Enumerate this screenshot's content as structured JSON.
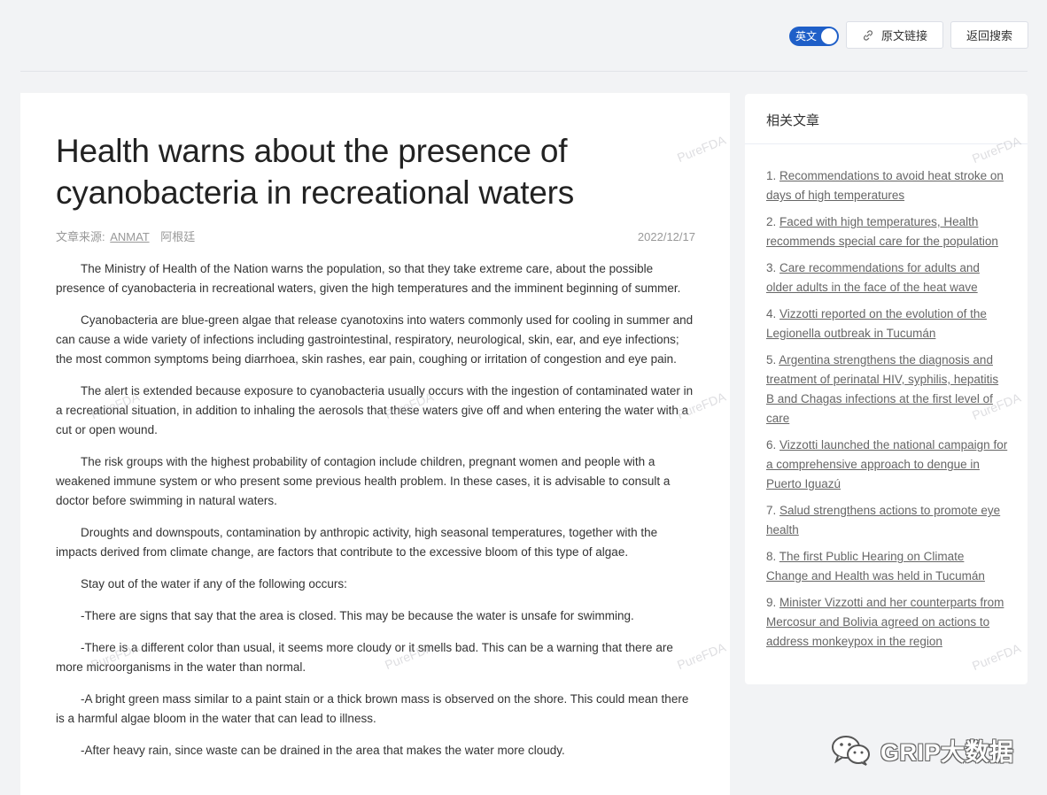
{
  "header": {
    "lang_toggle_label": "英文",
    "original_link_label": "原文链接",
    "back_label": "返回搜索"
  },
  "article": {
    "title": "Health warns about the presence of cyanobacteria in recreational waters",
    "source_label": "文章来源:",
    "source_name": "ANMAT",
    "country": "阿根廷",
    "date": "2022/12/17",
    "paragraphs": [
      "The Ministry of Health of the Nation warns the population, so that they take extreme care, about the possible presence of cyanobacteria in recreational waters, given the high temperatures and the imminent beginning of summer.",
      "Cyanobacteria are blue-green algae that release cyanotoxins into waters commonly used for cooling in summer and can cause a wide variety of infections including gastrointestinal, respiratory, neurological, skin, ear, and eye infections; the most common symptoms being diarrhoea, skin rashes, ear pain, coughing or irritation of congestion and eye pain.",
      "The alert is extended because exposure to cyanobacteria usually occurs with the ingestion of contaminated water in a recreational situation, in addition to inhaling the aerosols that these waters give off and when entering the water with a cut or open wound.",
      "The risk groups with the highest probability of contagion include children, pregnant women and people with a weakened immune system or who present some previous health problem. In these cases, it is advisable to consult a doctor before swimming in natural waters.",
      "Droughts and downspouts, contamination by anthropic activity, high seasonal temperatures, together with the impacts derived from climate change, are factors that contribute to the excessive bloom of this type of algae.",
      "Stay out of the water if any of the following occurs:",
      "-There are signs that say that the area is closed. This may be because the water is unsafe for swimming.",
      "-There is a different color than usual, it seems more cloudy or it smells bad. This can be a warning that there are more microorganisms in the water than normal.",
      "-A bright green mass similar to a paint stain or a thick brown mass is observed on the shore. This could mean there is a harmful algae bloom in the water that can lead to illness.",
      "-After heavy rain, since waste can be drained in the area that makes the water more cloudy."
    ]
  },
  "related": {
    "heading": "相关文章",
    "items": [
      {
        "num": "1.",
        "text": "Recommendations to avoid heat stroke on days of high temperatures"
      },
      {
        "num": "2.",
        "text": "Faced with high temperatures, Health recommends special care for the population"
      },
      {
        "num": "3.",
        "text": "Care recommendations for adults and older adults in the face of the heat wave"
      },
      {
        "num": "4.",
        "text": "Vizzotti reported on the evolution of the Legionella outbreak in Tucumán"
      },
      {
        "num": "5.",
        "text": "Argentina strengthens the diagnosis and treatment of perinatal HIV, syphilis, hepatitis B and Chagas infections at the first level of care"
      },
      {
        "num": "6.",
        "text": "Vizzotti launched the national campaign for a comprehensive approach to dengue in Puerto Iguazú"
      },
      {
        "num": "7.",
        "text": "Salud strengthens actions to promote eye health"
      },
      {
        "num": "8.",
        "text": "The first Public Hearing on Climate Change and Health was held in Tucumán"
      },
      {
        "num": "9.",
        "text": "Minister Vizzotti and her counterparts from Mercosur and Bolivia agreed on actions to address monkeypox in the region"
      }
    ]
  },
  "watermark": "PureFDA",
  "brand": {
    "text": "GRIP大数据",
    "icon": "wechat-icon"
  },
  "colors": {
    "accent": "#1f5fc8",
    "background": "#f2f3f5"
  }
}
